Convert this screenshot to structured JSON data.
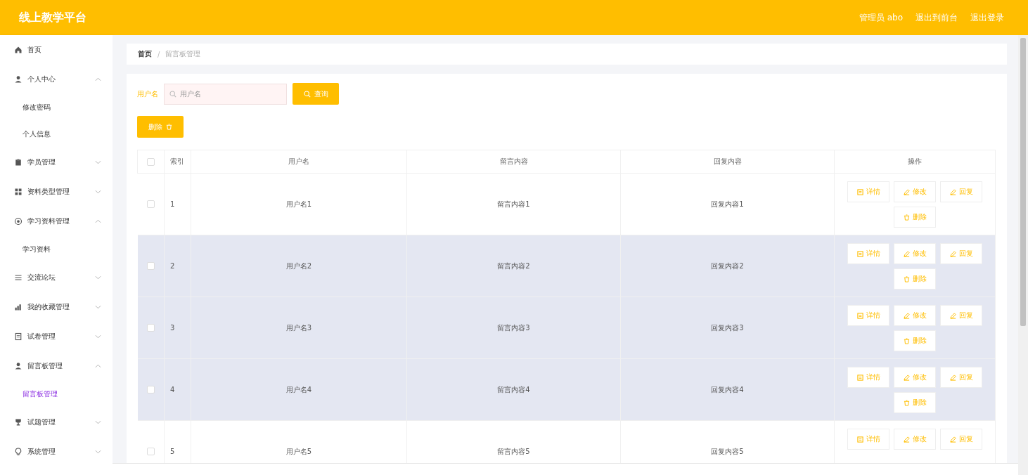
{
  "header": {
    "title": "线上教学平台",
    "links": [
      "管理员 abo",
      "退出到前台",
      "退出登录"
    ]
  },
  "sidebar": {
    "items": [
      {
        "label": "首页"
      },
      {
        "label": "个人中心",
        "expanded": true,
        "children": [
          {
            "label": "修改密码",
            "selected": false
          },
          {
            "label": "个人信息",
            "selected": false
          }
        ]
      },
      {
        "label": "学员管理",
        "expanded": false
      },
      {
        "label": "资料类型管理",
        "expanded": false
      },
      {
        "label": "学习资料管理",
        "expanded": true,
        "children": [
          {
            "label": "学习资料",
            "selected": false
          }
        ]
      },
      {
        "label": "交流论坛",
        "expanded": false
      },
      {
        "label": "我的收藏管理",
        "expanded": false
      },
      {
        "label": "试卷管理",
        "expanded": false
      },
      {
        "label": "留言板管理",
        "expanded": true,
        "children": [
          {
            "label": "留言板管理",
            "selected": true
          }
        ]
      },
      {
        "label": "试题管理",
        "expanded": false
      },
      {
        "label": "系统管理",
        "expanded": false
      }
    ]
  },
  "breadcrumb": {
    "items": [
      "首页",
      "留言板管理"
    ],
    "separator": "/"
  },
  "search": {
    "label": "用户名",
    "placeholder": "用户名",
    "button": "查询"
  },
  "delete_button": "删除",
  "table": {
    "columns": [
      "索引",
      "用户名",
      "留言内容",
      "回复内容",
      "操作"
    ],
    "header_checked": false,
    "rows": [
      {
        "index": "1",
        "username": "用户名1",
        "message": "留言内容1",
        "reply": "回复内容1",
        "checked": false,
        "highlighted": false,
        "actions": [
          {
            "label": "详情",
            "kind": "detail"
          },
          {
            "label": "修改",
            "kind": "edit"
          },
          {
            "label": "回复",
            "kind": "edit"
          },
          {
            "label": "删除",
            "kind": "delete"
          }
        ]
      },
      {
        "index": "2",
        "username": "用户名2",
        "message": "留言内容2",
        "reply": "回复内容2",
        "checked": false,
        "highlighted": true,
        "actions": [
          {
            "label": "详情",
            "kind": "detail"
          },
          {
            "label": "修改",
            "kind": "edit"
          },
          {
            "label": "回复",
            "kind": "edit"
          },
          {
            "label": "删除",
            "kind": "delete"
          }
        ]
      },
      {
        "index": "3",
        "username": "用户名3",
        "message": "留言内容3",
        "reply": "回复内容3",
        "checked": false,
        "highlighted": true,
        "actions": [
          {
            "label": "详情",
            "kind": "detail"
          },
          {
            "label": "修改",
            "kind": "edit"
          },
          {
            "label": "回复",
            "kind": "edit"
          },
          {
            "label": "删除",
            "kind": "delete"
          }
        ]
      },
      {
        "index": "4",
        "username": "用户名4",
        "message": "留言内容4",
        "reply": "回复内容4",
        "checked": false,
        "highlighted": true,
        "actions": [
          {
            "label": "详情",
            "kind": "detail"
          },
          {
            "label": "修改",
            "kind": "edit"
          },
          {
            "label": "回复",
            "kind": "edit"
          },
          {
            "label": "删除",
            "kind": "delete"
          }
        ]
      },
      {
        "index": "5",
        "username": "用户名5",
        "message": "留言内容5",
        "reply": "回复内容5",
        "checked": false,
        "highlighted": false,
        "actions": [
          {
            "label": "详情",
            "kind": "detail"
          },
          {
            "label": "修改",
            "kind": "edit"
          },
          {
            "label": "回复",
            "kind": "edit"
          }
        ]
      }
    ]
  }
}
